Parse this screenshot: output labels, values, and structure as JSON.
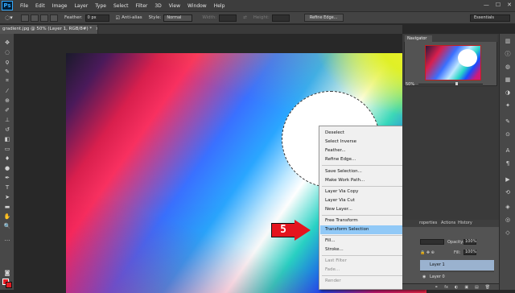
{
  "app": {
    "logo": "Ps"
  },
  "menubar": {
    "items": [
      "File",
      "Edit",
      "Image",
      "Layer",
      "Type",
      "Select",
      "Filter",
      "3D",
      "View",
      "Window",
      "Help"
    ],
    "window_controls": [
      "—",
      "☐",
      "✕"
    ]
  },
  "options": {
    "feather_label": "Feather:",
    "feather_value": "0 px",
    "antialias_label": "Anti-alias",
    "antialias_checked": true,
    "style_label": "Style:",
    "style_value": "Normal",
    "width_label": "Width:",
    "height_label": "Height:",
    "refine_edge_label": "Refine Edge...",
    "workspace_value": "Essentials"
  },
  "document": {
    "tab_title": "gradient.jpg @ 50% (Layer 1, RGB/8#) *",
    "tab_close": "×"
  },
  "annotation": {
    "step_number": "5",
    "arrow_color": "#e4141e"
  },
  "context_menu": {
    "items": [
      {
        "label": "Deselect",
        "enabled": true
      },
      {
        "label": "Select Inverse",
        "enabled": true
      },
      {
        "label": "Feather...",
        "enabled": true
      },
      {
        "label": "Refine Edge...",
        "enabled": true
      },
      {
        "label": "Save Selection...",
        "enabled": true
      },
      {
        "label": "Make Work Path...",
        "enabled": true
      },
      {
        "label": "Layer Via Copy",
        "enabled": true
      },
      {
        "label": "Layer Via Cut",
        "enabled": true
      },
      {
        "label": "New Layer...",
        "enabled": true
      },
      {
        "label": "Free Transform",
        "enabled": true
      },
      {
        "label": "Transform Selection",
        "enabled": true,
        "highlighted": true
      },
      {
        "label": "Fill...",
        "enabled": true
      },
      {
        "label": "Stroke...",
        "enabled": true
      },
      {
        "label": "Last Filter",
        "enabled": false
      },
      {
        "label": "Fade...",
        "enabled": false
      },
      {
        "label": "Render",
        "enabled": false
      }
    ]
  },
  "navigator": {
    "tab_label": "Navigator",
    "zoom": "50%"
  },
  "layers": {
    "tabs": [
      "roperties",
      "Actions",
      "History"
    ],
    "opacity_label": "Opacity:",
    "opacity_value": "100%",
    "fill_label": "Fill:",
    "fill_value": "100%",
    "rows": [
      {
        "name": "Layer 1",
        "selected": true
      },
      {
        "name": "Layer 0",
        "selected": false
      }
    ],
    "bottom_icons": [
      "⚭",
      "fx",
      "◐",
      "▣",
      "▤",
      "🗑"
    ]
  },
  "colors": {
    "foreground": "#e41b23",
    "background": "#e41b23",
    "menu_highlight": "#91c9f7"
  }
}
